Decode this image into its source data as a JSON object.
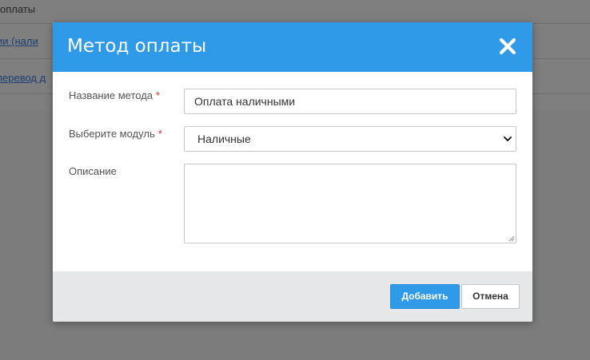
{
  "background": {
    "header_text": "оплаты",
    "row1_link": "ии (нали",
    "row2_link": "перевод д"
  },
  "modal": {
    "title": "Метод оплаты",
    "close_icon": "close-icon",
    "fields": {
      "name": {
        "label": "Название метода",
        "required_mark": "*",
        "value": "Оплата наличными"
      },
      "module": {
        "label": "Выберите модуль",
        "required_mark": "*",
        "selected": "Наличные"
      },
      "description": {
        "label": "Описание",
        "value": ""
      }
    },
    "buttons": {
      "add": "Добавить",
      "cancel": "Отмена"
    }
  },
  "colors": {
    "accent": "#2f9be8",
    "required": "#d93025",
    "overlay": "#7d7d7d"
  }
}
